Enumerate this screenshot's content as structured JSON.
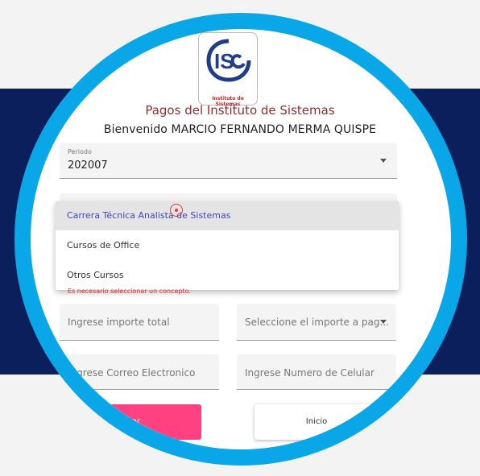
{
  "header": {
    "logo_caption": "Instituto de Sistemas",
    "title": "Pagos del Instituto de Sistemas",
    "welcome": "Bienvenido MARCIO FERNANDO MERMA QUISPE"
  },
  "form": {
    "periodo_label": "Periodo",
    "periodo_value": "202007",
    "concepto_options": [
      "Carrera Técnica Analista de Sistemas",
      "Cursos de Office",
      "Otros Cursos"
    ],
    "selected_option_index": 0,
    "concepto_error": "Es necesario seleccionar un concepto.",
    "importe_total_placeholder": "Ingrese importe total",
    "importe_pagar_placeholder": "Seleccione el importe a pag...",
    "correo_placeholder": "Ingrese Correo Electronico",
    "celular_placeholder": "Ingrese Numero de Celular"
  },
  "actions": {
    "pay_label": "Pagar",
    "home_label": "Inicio"
  },
  "colors": {
    "ring": "#0aa7e8",
    "band": "#0a1f5c",
    "pay_button": "#ff4081",
    "title": "#8a3030",
    "selected_option_text": "#3b48c0",
    "error_text": "#d32f2f"
  }
}
